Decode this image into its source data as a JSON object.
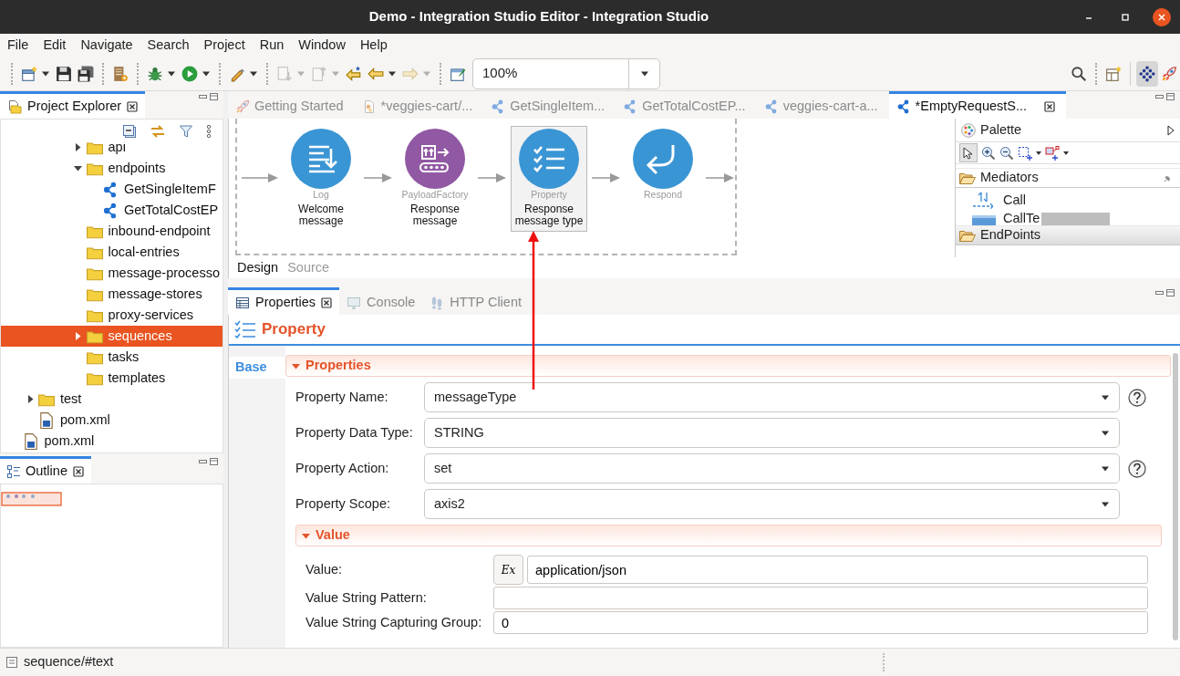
{
  "window": {
    "title": "Demo - Integration Studio Editor - Integration Studio"
  },
  "menu": [
    "File",
    "Edit",
    "Navigate",
    "Search",
    "Project",
    "Run",
    "Window",
    "Help"
  ],
  "toolbar": {
    "items": [
      {
        "kind": "new",
        "dropdown": true,
        "disabled": false
      },
      {
        "kind": "save",
        "dropdown": false,
        "disabled": false
      },
      {
        "kind": "saveall",
        "dropdown": false,
        "disabled": false
      },
      {
        "kind": "separator"
      },
      {
        "kind": "server",
        "dropdown": false,
        "disabled": false
      },
      {
        "kind": "separator"
      },
      {
        "kind": "debug",
        "dropdown": true,
        "disabled": false
      },
      {
        "kind": "run",
        "dropdown": true,
        "disabled": false
      },
      {
        "kind": "separator"
      },
      {
        "kind": "pen",
        "dropdown": true,
        "disabled": false
      },
      {
        "kind": "separator"
      },
      {
        "kind": "down",
        "dropdown": true,
        "disabled": true
      },
      {
        "kind": "up",
        "dropdown": true,
        "disabled": true
      },
      {
        "kind": "lastedit",
        "dropdown": false,
        "disabled": false
      },
      {
        "kind": "back",
        "dropdown": true,
        "disabled": false
      },
      {
        "kind": "forward",
        "dropdown": true,
        "disabled": true
      },
      {
        "kind": "separator"
      },
      {
        "kind": "openwin",
        "dropdown": false,
        "disabled": false
      }
    ],
    "zoom": "100%",
    "perspectives": [
      {
        "kind": "integration",
        "selected": true
      },
      {
        "kind": "rocket",
        "selected": false
      }
    ]
  },
  "project_explorer": {
    "title": "Project Explorer",
    "tree": [
      {
        "children": [
          {
            "children": [
              {
                "children": [
                  {
                    "children": [
                      {
                        "label": "api",
                        "kind": "folder",
                        "expanded": false,
                        "selected": false
                      },
                      {
                        "label": "endpoints",
                        "kind": "folder",
                        "expanded": true,
                        "selected": false,
                        "children": [
                          {
                            "label": "GetSingleItemF",
                            "kind": "endpoint",
                            "selected": false
                          },
                          {
                            "label": "GetTotalCostEP",
                            "kind": "endpoint",
                            "selected": false
                          }
                        ]
                      },
                      {
                        "label": "inbound-endpoint",
                        "kind": "folder",
                        "selected": false
                      },
                      {
                        "label": "local-entries",
                        "kind": "folder",
                        "selected": false
                      },
                      {
                        "label": "message-processo",
                        "kind": "folder",
                        "selected": false
                      },
                      {
                        "label": "message-stores",
                        "kind": "folder",
                        "selected": false
                      },
                      {
                        "label": "proxy-services",
                        "kind": "folder",
                        "selected": false
                      },
                      {
                        "label": "sequences",
                        "kind": "folder",
                        "expanded": false,
                        "selected": true
                      },
                      {
                        "label": "tasks",
                        "kind": "folder",
                        "selected": false
                      },
                      {
                        "label": "templates",
                        "kind": "folder",
                        "selected": false
                      }
                    ]
                  }
                ]
              }
            ]
          },
          {
            "label": "test",
            "kind": "folder",
            "expanded": false,
            "selected": false
          },
          {
            "label": "pom.xml",
            "kind": "pom",
            "selected": false
          }
        ]
      },
      {
        "label": "pom.xml",
        "kind": "pom",
        "selected": false
      }
    ]
  },
  "outline": {
    "title": "Outline"
  },
  "editor": {
    "tabs": [
      {
        "label": "Getting Started",
        "kind": "rocket",
        "selected": false
      },
      {
        "label": "*veggies-cart/...",
        "kind": "file",
        "selected": false
      },
      {
        "label": "GetSingleItem...",
        "kind": "endpoint",
        "selected": false
      },
      {
        "label": "GetTotalCostEP...",
        "kind": "endpoint",
        "selected": false
      },
      {
        "label": "veggies-cart-a...",
        "kind": "endpoint",
        "selected": false
      },
      {
        "label": "*EmptyRequestS...",
        "kind": "endpoint",
        "selected": true
      }
    ],
    "nodes": [
      {
        "type": "Log",
        "label": "Welcome message",
        "kind": "log",
        "color": "#3a95d4",
        "selected": false
      },
      {
        "type": "PayloadFactory",
        "label": "Response message",
        "kind": "payload",
        "color": "#9159a3",
        "selected": false
      },
      {
        "type": "Property",
        "label": "Response message type",
        "kind": "property",
        "color": "#3a95d4",
        "selected": true
      },
      {
        "type": "Respond",
        "kind": "respond",
        "color": "#3a95d4",
        "selected": false
      }
    ],
    "palette": {
      "title": "Palette",
      "drawers": [
        {
          "label": "Mediators",
          "expanded": true,
          "items": [
            {
              "label": "Call",
              "kind": "call"
            },
            {
              "label": "CallTe",
              "kind": "template"
            }
          ]
        },
        {
          "label": "EndPoints",
          "expanded": false
        }
      ]
    },
    "view_tabs": [
      {
        "label": "Design",
        "selected": true
      },
      {
        "label": "Source",
        "selected": false
      }
    ]
  },
  "properties_view": {
    "tabs": [
      {
        "label": "Properties",
        "kind": "properties",
        "selected": true
      },
      {
        "label": "Console",
        "kind": "console",
        "selected": false
      },
      {
        "label": "HTTP Client",
        "kind": "http",
        "selected": false
      }
    ],
    "heading": "Property",
    "side_tabs": [
      {
        "label": "Base",
        "selected": true
      }
    ],
    "section": {
      "title": "Properties",
      "expanded": true,
      "fields": [
        {
          "label": "Property Name:",
          "kind": "combo",
          "value": "messageType",
          "help": true
        },
        {
          "label": "Property Data Type:",
          "kind": "combo",
          "value": "STRING",
          "help": false
        },
        {
          "label": "Property Action:",
          "kind": "combo",
          "value": "set",
          "help": true
        },
        {
          "label": "Property Scope:",
          "kind": "combo",
          "value": "axis2",
          "help": false
        }
      ],
      "subsection": {
        "title": "Value",
        "expanded": true,
        "fields": [
          {
            "label": "Value:",
            "kind": "expression",
            "button": "Ex",
            "value": "application/json"
          },
          {
            "label": "Value String Pattern:",
            "kind": "text"
          },
          {
            "label": "Value String Capturing Group:",
            "kind": "text",
            "value": "0"
          }
        ]
      }
    }
  },
  "status_bar": {
    "text": "sequence/#text"
  }
}
